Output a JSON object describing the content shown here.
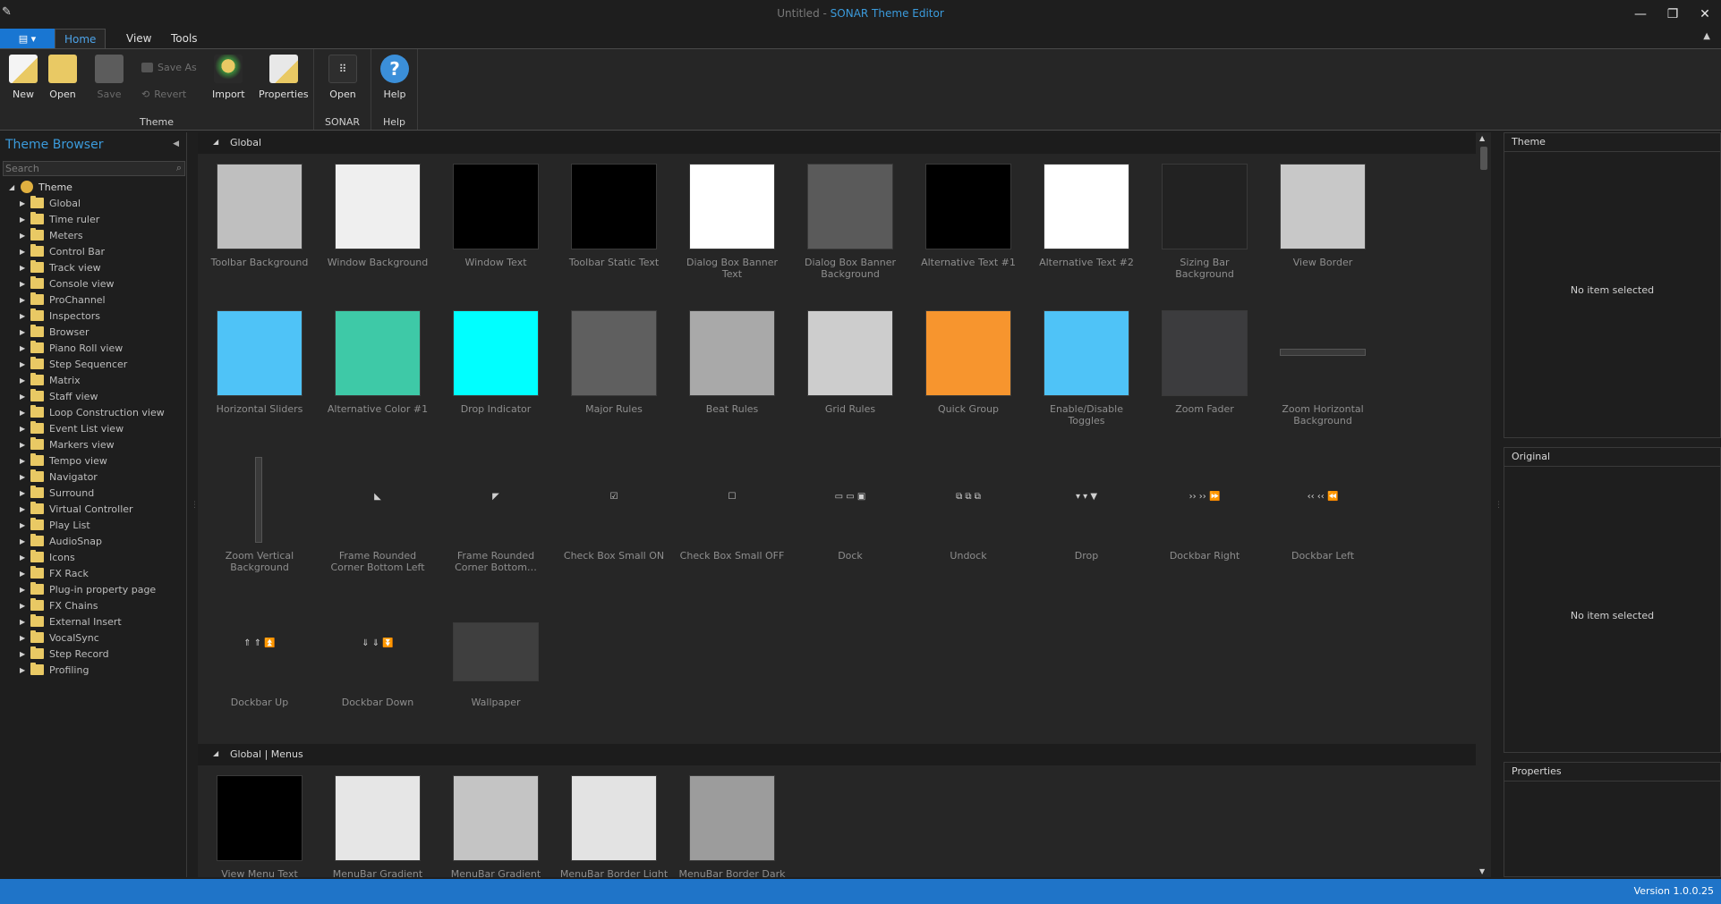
{
  "titlebar": {
    "doc": "Untitled",
    "separator": " - ",
    "app": "SONAR Theme Editor",
    "minimize_glyph": "—",
    "restore_glyph": "❐",
    "close_glyph": "✕"
  },
  "ribbon_tabs": [
    "Home",
    "View",
    "Tools"
  ],
  "ribbon": {
    "theme_group": "Theme",
    "sonar_group": "SONAR",
    "help_group": "Help",
    "new": "New",
    "open": "Open",
    "save": "Save",
    "save_as": "Save As",
    "revert": "Revert",
    "import": "Import",
    "properties": "Properties",
    "sonar_open": "Open",
    "help": "Help"
  },
  "browser": {
    "title": "Theme Browser",
    "search_placeholder": "Search",
    "root": "Theme",
    "items": [
      "Global",
      "Time ruler",
      "Meters",
      "Control Bar",
      "Track view",
      "Console view",
      "ProChannel",
      "Inspectors",
      "Browser",
      "Piano Roll view",
      "Step Sequencer",
      "Matrix",
      "Staff view",
      "Loop Construction view",
      "Event List view",
      "Markers view",
      "Tempo view",
      "Navigator",
      "Surround",
      "Virtual Controller",
      "Play List",
      "AudioSnap",
      "Icons",
      "FX Rack",
      "Plug-in property page",
      "FX Chains",
      "External Insert",
      "VocalSync",
      "Step Record",
      "Profiling"
    ]
  },
  "sections": [
    {
      "title": "Global",
      "rows": [
        [
          {
            "label": "Toolbar Background",
            "type": "swatch",
            "color": "#bfbfbf"
          },
          {
            "label": "Window Background",
            "type": "swatch",
            "color": "#efefef"
          },
          {
            "label": "Window Text",
            "type": "swatch",
            "color": "#000000"
          },
          {
            "label": "Toolbar Static Text",
            "type": "swatch",
            "color": "#000000"
          },
          {
            "label": "Dialog Box Banner Text",
            "type": "swatch",
            "color": "#ffffff"
          },
          {
            "label": "Dialog Box Banner Background",
            "type": "swatch",
            "color": "#5a5a5a"
          },
          {
            "label": "Alternative Text #1",
            "type": "swatch",
            "color": "#000000"
          },
          {
            "label": "Alternative Text #2",
            "type": "swatch",
            "color": "#ffffff"
          },
          {
            "label": "Sizing Bar Background",
            "type": "swatch",
            "color": "#222222"
          },
          {
            "label": "View Border",
            "type": "swatch",
            "color": "#c8c8c8"
          }
        ],
        [
          {
            "label": "Horizontal Sliders",
            "type": "swatch",
            "color": "#4fc3f7"
          },
          {
            "label": "Alternative Color #1",
            "type": "swatch",
            "color": "#3ec9a7"
          },
          {
            "label": "Drop Indicator",
            "type": "swatch",
            "color": "#00ffff"
          },
          {
            "label": "Major Rules",
            "type": "swatch",
            "color": "#5f5f5f"
          },
          {
            "label": "Beat Rules",
            "type": "swatch",
            "color": "#a9a9a9"
          },
          {
            "label": "Grid Rules",
            "type": "swatch",
            "color": "#cdcdcd"
          },
          {
            "label": "Quick Group",
            "type": "swatch",
            "color": "#f7952e"
          },
          {
            "label": "Enable/Disable Toggles",
            "type": "swatch",
            "color": "#4fc3f7"
          },
          {
            "label": "Zoom Fader",
            "type": "swatch",
            "color": "#3c3c3e"
          },
          {
            "label": "Zoom Horizontal Background",
            "type": "hbar",
            "color": "#3a3a3a"
          }
        ],
        [
          {
            "label": "Zoom Vertical Background",
            "type": "vbar",
            "color": "#3a3a3a"
          },
          {
            "label": "Frame Rounded Corner Bottom Left",
            "type": "glyph",
            "glyph": "◣"
          },
          {
            "label": "Frame Rounded Corner Bottom…",
            "type": "glyph",
            "glyph": "◤"
          },
          {
            "label": "Check Box Small ON",
            "type": "glyph",
            "glyph": "☑"
          },
          {
            "label": "Check Box Small OFF",
            "type": "glyph",
            "glyph": "☐"
          },
          {
            "label": "Dock",
            "type": "glyph",
            "glyph": "▭ ▭ ▣"
          },
          {
            "label": "Undock",
            "type": "glyph",
            "glyph": "⧉ ⧉ ⧉"
          },
          {
            "label": "Drop",
            "type": "glyph",
            "glyph": "▾ ▾ ▼"
          },
          {
            "label": "Dockbar Right",
            "type": "glyph",
            "glyph": "›› ›› ⏩"
          },
          {
            "label": "Dockbar Left",
            "type": "glyph",
            "glyph": "‹‹ ‹‹ ⏪"
          }
        ],
        [
          {
            "label": "Dockbar Up",
            "type": "glyph",
            "glyph": "⇑ ⇑ ⏫"
          },
          {
            "label": "Dockbar Down",
            "type": "glyph",
            "glyph": "⇓ ⇓ ⏬"
          },
          {
            "label": "Wallpaper",
            "type": "wallpaper",
            "color": "#3f3f3f"
          }
        ]
      ]
    },
    {
      "title": "Global | Menus",
      "rows": [
        [
          {
            "label": "View Menu Text",
            "type": "swatch",
            "color": "#000000"
          },
          {
            "label": "MenuBar Gradient Start",
            "type": "swatch",
            "color": "#e6e6e6"
          },
          {
            "label": "MenuBar Gradient End",
            "type": "swatch",
            "color": "#c4c4c4"
          },
          {
            "label": "MenuBar Border Light",
            "type": "swatch",
            "color": "#e3e3e3"
          },
          {
            "label": "MenuBar Border Dark",
            "type": "swatch",
            "color": "#9c9c9c"
          }
        ]
      ]
    }
  ],
  "panels": {
    "theme_title": "Theme",
    "original_title": "Original",
    "properties_title": "Properties",
    "empty": "No item selected"
  },
  "status": {
    "version": "Version 1.0.0.25"
  }
}
